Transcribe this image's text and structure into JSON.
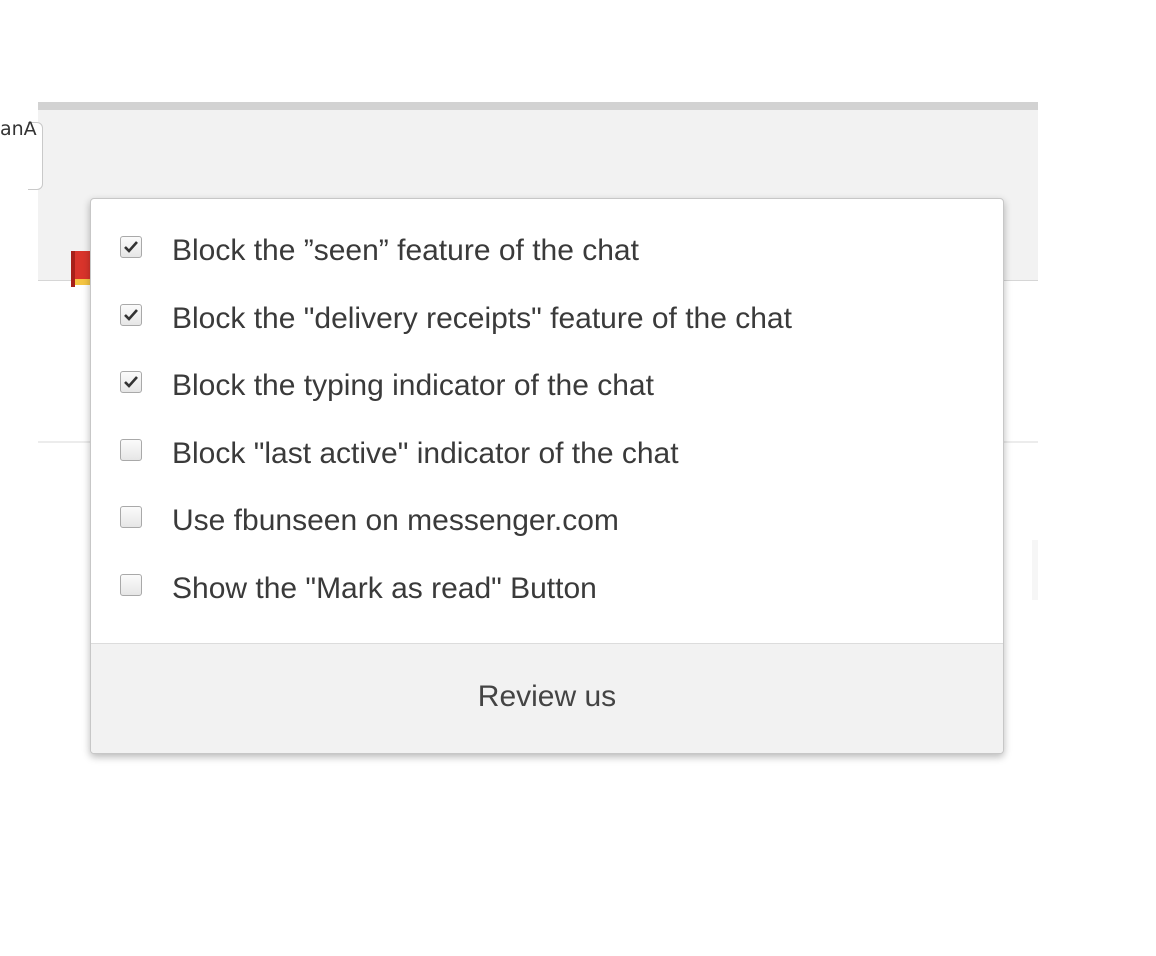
{
  "toolbar": {
    "bookmark_fragment": "anA",
    "extensions": [
      {
        "icon": "pdf-book-icon"
      },
      {
        "icon": "php-icon"
      },
      {
        "icon": "download-arrow-icon"
      },
      {
        "icon": "off-page-icon"
      },
      {
        "icon": "fast-forward-icon"
      },
      {
        "icon": "download-icon"
      },
      {
        "icon": "inbox-check-icon"
      },
      {
        "icon": "rainbow-arc-icon"
      },
      {
        "icon": "magnifier-icon"
      },
      {
        "icon": "google-translate-icon"
      },
      {
        "icon": "grid-dots-icon"
      },
      {
        "icon": "fbunseen-eye-icon"
      }
    ]
  },
  "popup": {
    "options": [
      {
        "label": "Block the ”seen” feature of the chat",
        "checked": true
      },
      {
        "label": "Block the \"delivery receipts\" feature of the chat",
        "checked": true
      },
      {
        "label": "Block the typing indicator of the chat",
        "checked": true
      },
      {
        "label": "Block \"last active\" indicator of the chat",
        "checked": false
      },
      {
        "label": "Use fbunseen on messenger.com",
        "checked": false
      },
      {
        "label": "Show the \"Mark as read\" Button",
        "checked": false
      }
    ],
    "footer_link": "Review us"
  },
  "colors": {
    "accent_blue": "#1e88e5",
    "popup_footer_bg": "#f2f2f2",
    "text": "#3a3a3a"
  }
}
